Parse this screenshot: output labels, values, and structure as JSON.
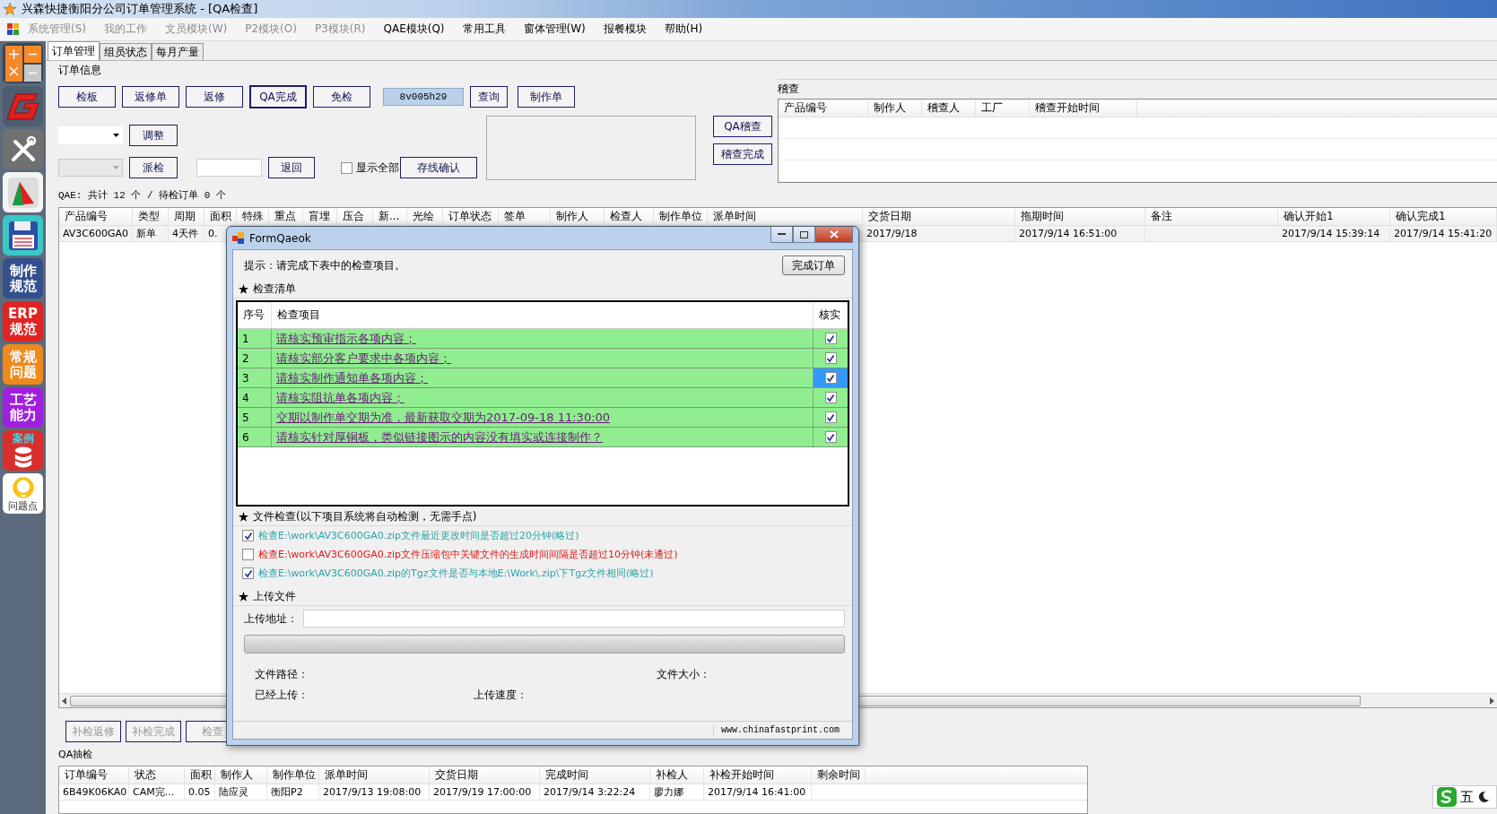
{
  "window": {
    "title": "兴森快捷衡阳分公司订单管理系统 - [QA检查]"
  },
  "menu": [
    {
      "label": "系统管理(S)",
      "disabled": true
    },
    {
      "label": "我的工作",
      "disabled": true
    },
    {
      "label": "文员模块(W)",
      "disabled": true
    },
    {
      "label": "P2模块(O)",
      "disabled": true
    },
    {
      "label": "P3模块(R)",
      "disabled": true
    },
    {
      "label": "QAE模块(Q)",
      "disabled": false
    },
    {
      "label": "常用工具",
      "disabled": false
    },
    {
      "label": "窗体管理(W)",
      "disabled": false
    },
    {
      "label": "报餐模块",
      "disabled": false
    },
    {
      "label": "帮助(H)",
      "disabled": false
    }
  ],
  "sidebar": [
    {
      "kind": "calculator"
    },
    {
      "kind": "g-logo"
    },
    {
      "kind": "tools"
    },
    {
      "kind": "chart"
    },
    {
      "kind": "floppy"
    },
    {
      "kind": "tile",
      "label": "制作规范",
      "color": "#33508c"
    },
    {
      "kind": "tile",
      "label": "ERP规范",
      "color": "#e02424"
    },
    {
      "kind": "tile",
      "label": "常规问题",
      "color": "#ee8a1c"
    },
    {
      "kind": "tile",
      "label": "工艺能力",
      "color": "#a020e0"
    },
    {
      "kind": "database",
      "label": "案例"
    },
    {
      "kind": "bulb",
      "label": "问题点"
    }
  ],
  "tabs": [
    {
      "label": "订单管理",
      "selected": true
    },
    {
      "label": "组员状态",
      "selected": false
    },
    {
      "label": "每月产量",
      "selected": false
    }
  ],
  "order_info": {
    "title": "订单信息",
    "buttons": [
      {
        "label": "检板",
        "focused": false
      },
      {
        "label": "返修单",
        "focused": false
      },
      {
        "label": "返修",
        "focused": false
      },
      {
        "label": "QA完成",
        "focused": true
      },
      {
        "label": "免检",
        "focused": false
      }
    ],
    "code": "8v005h29",
    "query_button": "查询",
    "make_button": "制作单",
    "dropdowns": [
      {
        "disabled": false
      },
      {
        "disabled": true
      }
    ],
    "adjust_button": "调整",
    "dispatch_button": "派检",
    "return_button": "退回",
    "show_all": {
      "label": "显示全部",
      "checked": false
    },
    "confirm_button": "存线确认",
    "audit_buttons": [
      "QA稽查",
      "稽查完成"
    ]
  },
  "audit": {
    "title": "稽查",
    "columns": [
      "产品编号",
      "制作人",
      "稽查人",
      "工厂",
      "稽查开始时间"
    ]
  },
  "summary": "QAE: 共计 12 个 / 待检订单 0 个",
  "orders": {
    "columns": [
      "产品编号",
      "类型",
      "周期",
      "面积",
      "特殊",
      "重点",
      "盲埋",
      "压合",
      "新...",
      "光绘",
      "订单状态",
      "签单",
      "制作人",
      "检查人",
      "制作单位",
      "派单时间",
      "交货日期",
      "拖期时间",
      "备注",
      "确认开始1",
      "确认完成1"
    ],
    "rows": [
      {
        "cells": [
          "AV3C600GA0",
          "新单",
          "4天件",
          "0.",
          null,
          null,
          null,
          null,
          null,
          null,
          null,
          null,
          null,
          null,
          null,
          null,
          "2017/9/18",
          "2017/9/14 16:51:00",
          null,
          "2017/9/14 15:39:14",
          "2017/9/14 15:41:20"
        ]
      }
    ]
  },
  "bottom_buttons": [
    {
      "label": "补检返修",
      "disabled": true
    },
    {
      "label": "补检完成",
      "disabled": true
    },
    {
      "label": "检查",
      "disabled": true
    }
  ],
  "spot_check": {
    "title": "QA抽检",
    "columns": [
      "订单编号",
      "状态",
      "面积",
      "制作人",
      "制作单位",
      "派单时间",
      "交货日期",
      "完成时间",
      "补检人",
      "补检开始时间",
      "剩余时间"
    ],
    "rows": [
      {
        "cells": [
          "6B49K06KA0",
          "CAM完...",
          "0.05",
          "陆应灵",
          "衡阳P2",
          "2017/9/13 19:08:00",
          "2017/9/19 17:00:00",
          "2017/9/14 3:22:24",
          "廖力娜",
          "2017/9/14 16:41:00",
          null
        ]
      }
    ]
  },
  "dialog": {
    "title": "FormQaeok",
    "hint": "提示：请完成下表中的检查项目。",
    "finish_button": "完成订单",
    "checklist": {
      "title": "检查清单",
      "columns": [
        "序号",
        "检查项目",
        "核实"
      ],
      "rows": [
        {
          "index": "1",
          "text": "请核实预审指示各项内容；",
          "checked": true,
          "selected": false
        },
        {
          "index": "2",
          "text": "请核实部分客户要求中各项内容；",
          "checked": true,
          "selected": false
        },
        {
          "index": "3",
          "text": "请核实制作通知单各项内容；",
          "checked": true,
          "selected": true
        },
        {
          "index": "4",
          "text": "请核实阻抗单各项内容；",
          "checked": true,
          "selected": false
        },
        {
          "index": "5",
          "text": "交期以制作单交期为准，最新获取交期为2017-09-18 11:30:00",
          "checked": true,
          "selected": false
        },
        {
          "index": "6",
          "text": "请核实针对厚铜板，类似链接图示的内容没有填实或连接制作？",
          "checked": true,
          "selected": false
        }
      ]
    },
    "file_check": {
      "title": "文件检查(以下项目系统将自动检测，无需手点)",
      "items": [
        {
          "text": "检查E:\\work\\AV3C600GA0.zip文件最近更改时间是否超过20分钟(略过)",
          "checked": true,
          "color": "#2ba3a8"
        },
        {
          "text": "检查E:\\work\\AV3C600GA0.zip文件压缩包中关键文件的生成时间间隔是否超过10分钟(未通过)",
          "checked": false,
          "color": "#e01818"
        },
        {
          "text": "检查E:\\work\\AV3C600GA0.zip的Tgz文件是否与本地E:\\Work\\.zip\\下Tgz文件相同(略过)",
          "checked": true,
          "color": "#2ba3a8"
        }
      ]
    },
    "upload": {
      "title": "上传文件",
      "address_label": "上传地址：",
      "progress": {
        "level": 0
      },
      "path_label": "文件路径：",
      "size_label": "文件大小：",
      "uploaded_label": "已经上传：",
      "speed_label": "上传速度："
    },
    "status": "www.chinafastprint.com"
  },
  "ime": {
    "mode": "五"
  }
}
